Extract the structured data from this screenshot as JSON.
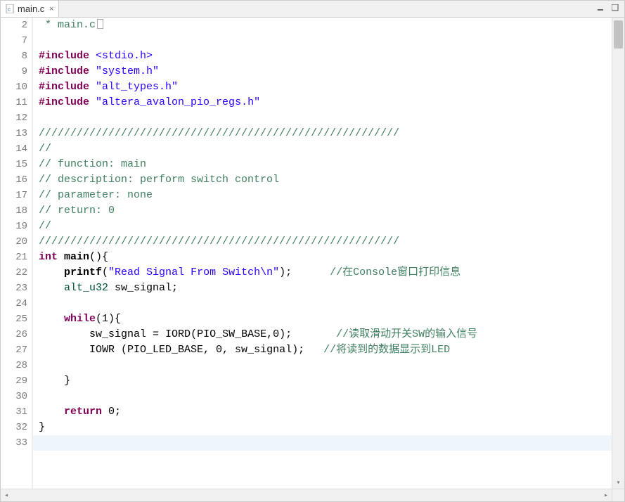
{
  "tab": {
    "label": "main.c",
    "icon": "c-file-icon",
    "close": "×"
  },
  "window_controls": {
    "minimize": "min-icon",
    "maximize": "max-icon"
  },
  "gutter": {
    "start": 2,
    "lines": [
      "2",
      "7",
      "8",
      "9",
      "10",
      "11",
      "12",
      "13",
      "14",
      "15",
      "16",
      "17",
      "18",
      "19",
      "20",
      "21",
      "22",
      "23",
      "24",
      "25",
      "26",
      "27",
      "28",
      "29",
      "30",
      "31",
      "32",
      "33"
    ],
    "folds": {
      "0": "plus",
      "11": "minus",
      "14": "minus"
    }
  },
  "code": {
    "l0": {
      "comment": " * main.c",
      "has_box": true
    },
    "l1": {
      "blank": true
    },
    "l2": {
      "pp": "#include",
      "target": "<stdio.h>",
      "sys": true
    },
    "l3": {
      "pp": "#include",
      "target": "\"system.h\"",
      "sys": false
    },
    "l4": {
      "pp": "#include",
      "target": "\"alt_types.h\"",
      "sys": false
    },
    "l5": {
      "pp": "#include",
      "target": "\"altera_avalon_pio_regs.h\"",
      "sys": false
    },
    "l6": {
      "blank": true
    },
    "l7": {
      "comment": "/////////////////////////////////////////////////////////"
    },
    "l8": {
      "comment": "//"
    },
    "l9": {
      "comment": "// function: main"
    },
    "l10": {
      "comment": "// description: perform switch control"
    },
    "l11": {
      "comment": "// parameter: none"
    },
    "l12": {
      "comment": "// return: 0"
    },
    "l13": {
      "comment": "//"
    },
    "l14": {
      "comment": "/////////////////////////////////////////////////////////"
    },
    "l15": {
      "kw": "int",
      "rest": " main(){",
      "fn": "main"
    },
    "l16": {
      "indent": "    ",
      "call": "printf",
      "args_l": "(",
      "str": "\"Read Signal From Switch\\n\"",
      "args_r": ");",
      "trail_pad": "      ",
      "trail_comment": "//在Console窗口打印信息"
    },
    "l17": {
      "indent": "    ",
      "type": "alt_u32",
      "var": " sw_signal",
      "tail": ";"
    },
    "l18": {
      "blank": true
    },
    "l19": {
      "indent": "    ",
      "kw": "while",
      "rest": "(1){"
    },
    "l20": {
      "indent": "        ",
      "lhs": "sw_signal",
      "assign": " = ",
      "call": "IORD",
      "args": "(PIO_SW_BASE,0);",
      "trail_pad": "       ",
      "trail_comment": "//读取滑动开关SW的输入信号"
    },
    "l21": {
      "indent": "        ",
      "call": "IOWR",
      "args": " (PIO_LED_BASE, 0, sw_signal);",
      "trail_pad": "   ",
      "trail_comment": "//将读到的数据显示到LED"
    },
    "l22": {
      "blank": true
    },
    "l23": {
      "indent": "    ",
      "text": "}"
    },
    "l24": {
      "blank": true
    },
    "l25": {
      "indent": "    ",
      "kw": "return",
      "rest": " 0;"
    },
    "l26": {
      "text": "}"
    },
    "l27": {
      "blank": true,
      "current": true
    }
  }
}
